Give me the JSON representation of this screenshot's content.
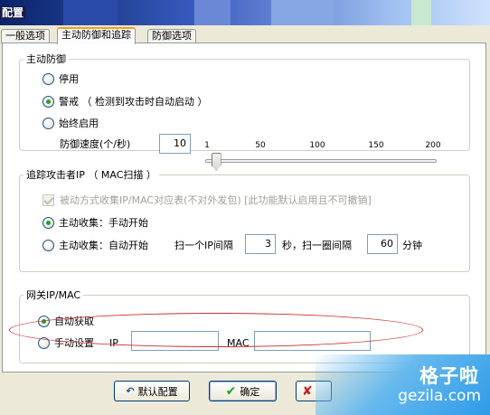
{
  "window": {
    "title": "配置"
  },
  "tabs": [
    {
      "label": "一般选项"
    },
    {
      "label": "主动防御和追踪"
    },
    {
      "label": "防御选项"
    }
  ],
  "active_defense": {
    "legend": "主动防御",
    "options": [
      {
        "label": "停用",
        "selected": false
      },
      {
        "label": "警戒 （ 检测到攻击时自动启动 ）",
        "selected": true
      },
      {
        "label": "始终启用",
        "selected": false
      }
    ],
    "speed_label": "防御速度(个/秒)",
    "speed_value": "10",
    "slider": {
      "min": 1,
      "max": 200,
      "value": 10,
      "tick_labels": [
        "1",
        "50",
        "100",
        "150",
        "200"
      ]
    }
  },
  "trace": {
    "legend": "追踪攻击者IP （ MAC扫描 ）",
    "passive_checkbox": {
      "label": "被动方式收集IP/MAC对应表(不对外发包) [此功能默认启用且不可撤销]",
      "checked": true
    },
    "manual_option": {
      "label": "主动收集：手动开始",
      "selected": true
    },
    "auto_option": {
      "label": "主动收集：自动开始",
      "selected": false
    },
    "interval_label": "扫一个IP间隔",
    "interval_value": "3",
    "interval_unit": "秒，扫一圈间隔",
    "round_value": "60",
    "round_unit": "分钟"
  },
  "gateway": {
    "legend": "网关IP/MAC",
    "auto_option": {
      "label": "自动获取",
      "selected": true
    },
    "manual_option": {
      "label": "手动设置",
      "selected": false
    },
    "ip_label": "IP",
    "ip_value": "",
    "mac_label": "MAC",
    "mac_value": ""
  },
  "buttons": {
    "default_config": "默认配置",
    "ok": "确定"
  },
  "watermark": {
    "cn": "格子啦",
    "en": "gezila.com"
  },
  "colors": {
    "accent_orange": "#ff9c1e",
    "annotation_red": "#cc3030",
    "check_green": "#21a121"
  }
}
